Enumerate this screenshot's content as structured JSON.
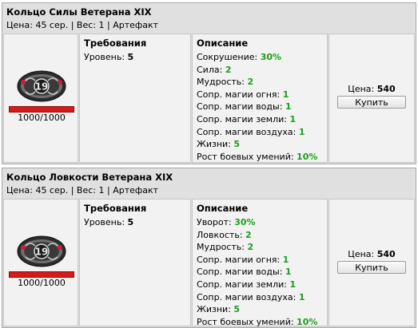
{
  "items": [
    {
      "name": "Кольцо Силы Ветерана XIX",
      "meta": "Цена: 45 сер. | Вес: 1 | Артефакт",
      "durability": {
        "text": "1000/1000",
        "fraction": 1.0
      },
      "requirements": {
        "title": "Требования",
        "level_label": "Уровень: ",
        "level_value": "5"
      },
      "description": {
        "title": "Описание",
        "stats": [
          {
            "label": "Сокрушение: ",
            "value": "30%",
            "color": "#1c9e1c"
          },
          {
            "label": "Сила: ",
            "value": "2",
            "color": "#1c9e1c"
          },
          {
            "label": "Мудрость: ",
            "value": "2",
            "color": "#1c9e1c"
          },
          {
            "label": "Сопр. магии огня: ",
            "value": "1",
            "color": "#1c9e1c"
          },
          {
            "label": "Сопр. магии воды: ",
            "value": "1",
            "color": "#1c9e1c"
          },
          {
            "label": "Сопр. магии земли: ",
            "value": "1",
            "color": "#1c9e1c"
          },
          {
            "label": "Сопр. магии воздуха: ",
            "value": "1",
            "color": "#1c9e1c"
          },
          {
            "label": "Жизни: ",
            "value": "5",
            "color": "#1c9e1c"
          },
          {
            "label": "Рост боевых умений: ",
            "value": "10%",
            "color": "#1c9e1c"
          }
        ]
      },
      "price_label": "Цена: ",
      "price_value": "540",
      "buy_label": "Купить"
    },
    {
      "name": "Кольцо Ловкости Ветерана XIX",
      "meta": "Цена: 45 сер. | Вес: 1 | Артефакт",
      "durability": {
        "text": "1000/1000",
        "fraction": 1.0
      },
      "requirements": {
        "title": "Требования",
        "level_label": "Уровень: ",
        "level_value": "5"
      },
      "description": {
        "title": "Описание",
        "stats": [
          {
            "label": "Уворот: ",
            "value": "30%",
            "color": "#1c9e1c"
          },
          {
            "label": "Ловкость: ",
            "value": "2",
            "color": "#1c9e1c"
          },
          {
            "label": "Мудрость: ",
            "value": "2",
            "color": "#1c9e1c"
          },
          {
            "label": "Сопр. магии огня: ",
            "value": "1",
            "color": "#1c9e1c"
          },
          {
            "label": "Сопр. магии воды: ",
            "value": "1",
            "color": "#1c9e1c"
          },
          {
            "label": "Сопр. магии земли: ",
            "value": "1",
            "color": "#1c9e1c"
          },
          {
            "label": "Сопр. магии воздуха: ",
            "value": "1",
            "color": "#1c9e1c"
          },
          {
            "label": "Жизни: ",
            "value": "5",
            "color": "#1c9e1c"
          },
          {
            "label": "Рост боевых умений: ",
            "value": "10%",
            "color": "#1c9e1c"
          }
        ]
      },
      "price_label": "Цена: ",
      "price_value": "540",
      "buy_label": "Купить"
    }
  ],
  "icons": {
    "ring": "ring-icon"
  },
  "colors": {
    "stat_value": "#1c9e1c",
    "durability_bar": "#d61a1a",
    "card_bg": "#e0e0e0",
    "panel_bg": "#f2f2f2"
  }
}
